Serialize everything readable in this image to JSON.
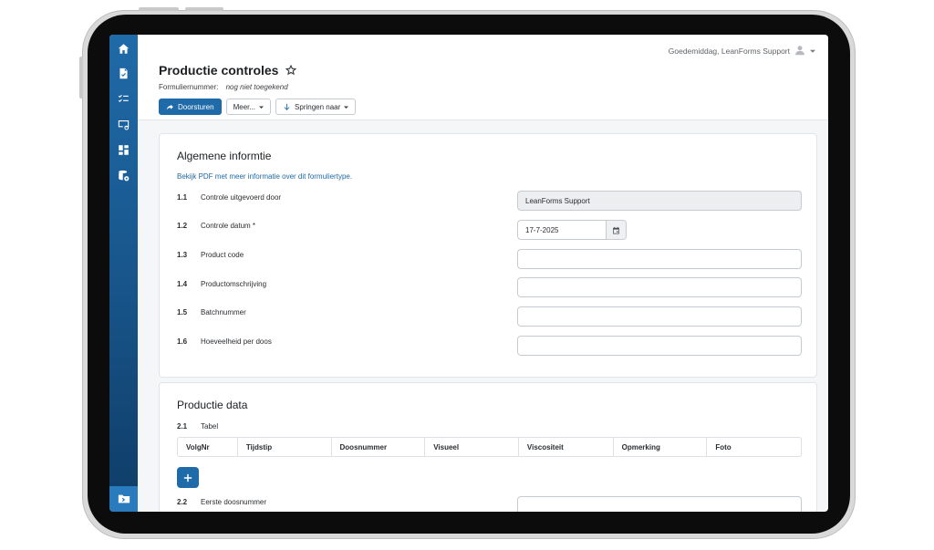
{
  "header": {
    "greeting": "Goedemiddag, LeanForms Support",
    "title": "Productie controles",
    "form_number_label": "Formuliernummer:",
    "form_number_value": "nog niet toegekend"
  },
  "toolbar": {
    "forward_label": "Doorsturen",
    "more_label": "Meer...",
    "jump_label": "Springen naar"
  },
  "sidebar": {
    "items": [
      "home-icon",
      "document-icon",
      "checklist-icon",
      "screen-settings-icon",
      "dashboard-icon",
      "database-settings-icon"
    ],
    "bottom": "folder-icon"
  },
  "section1": {
    "title": "Algemene informtie",
    "pdf_link": "Bekijk PDF met meer informatie over dit formuliertype.",
    "questions": [
      {
        "num": "1.1",
        "label": "Controle uitgevoerd door",
        "value": "LeanForms Support"
      },
      {
        "num": "1.2",
        "label": "Controle datum *",
        "value": "17-7-2025"
      },
      {
        "num": "1.3",
        "label": "Product code",
        "value": ""
      },
      {
        "num": "1.4",
        "label": "Productomschrijving",
        "value": ""
      },
      {
        "num": "1.5",
        "label": "Batchnummer",
        "value": ""
      },
      {
        "num": "1.6",
        "label": "Hoeveelheid per doos",
        "value": ""
      }
    ]
  },
  "section2": {
    "title": "Productie data",
    "table_num": "2.1",
    "table_label": "Tabel",
    "columns": [
      "VolgNr",
      "Tijdstip",
      "Doosnummer",
      "Visueel",
      "Viscositeit",
      "Opmerking",
      "Foto"
    ],
    "next_num": "2.2",
    "next_label": "Eerste doosnummer"
  },
  "colors": {
    "accent": "#1f6aa8",
    "sidebar_top": "#1f6aa8",
    "sidebar_bottom": "#0f3c66"
  }
}
